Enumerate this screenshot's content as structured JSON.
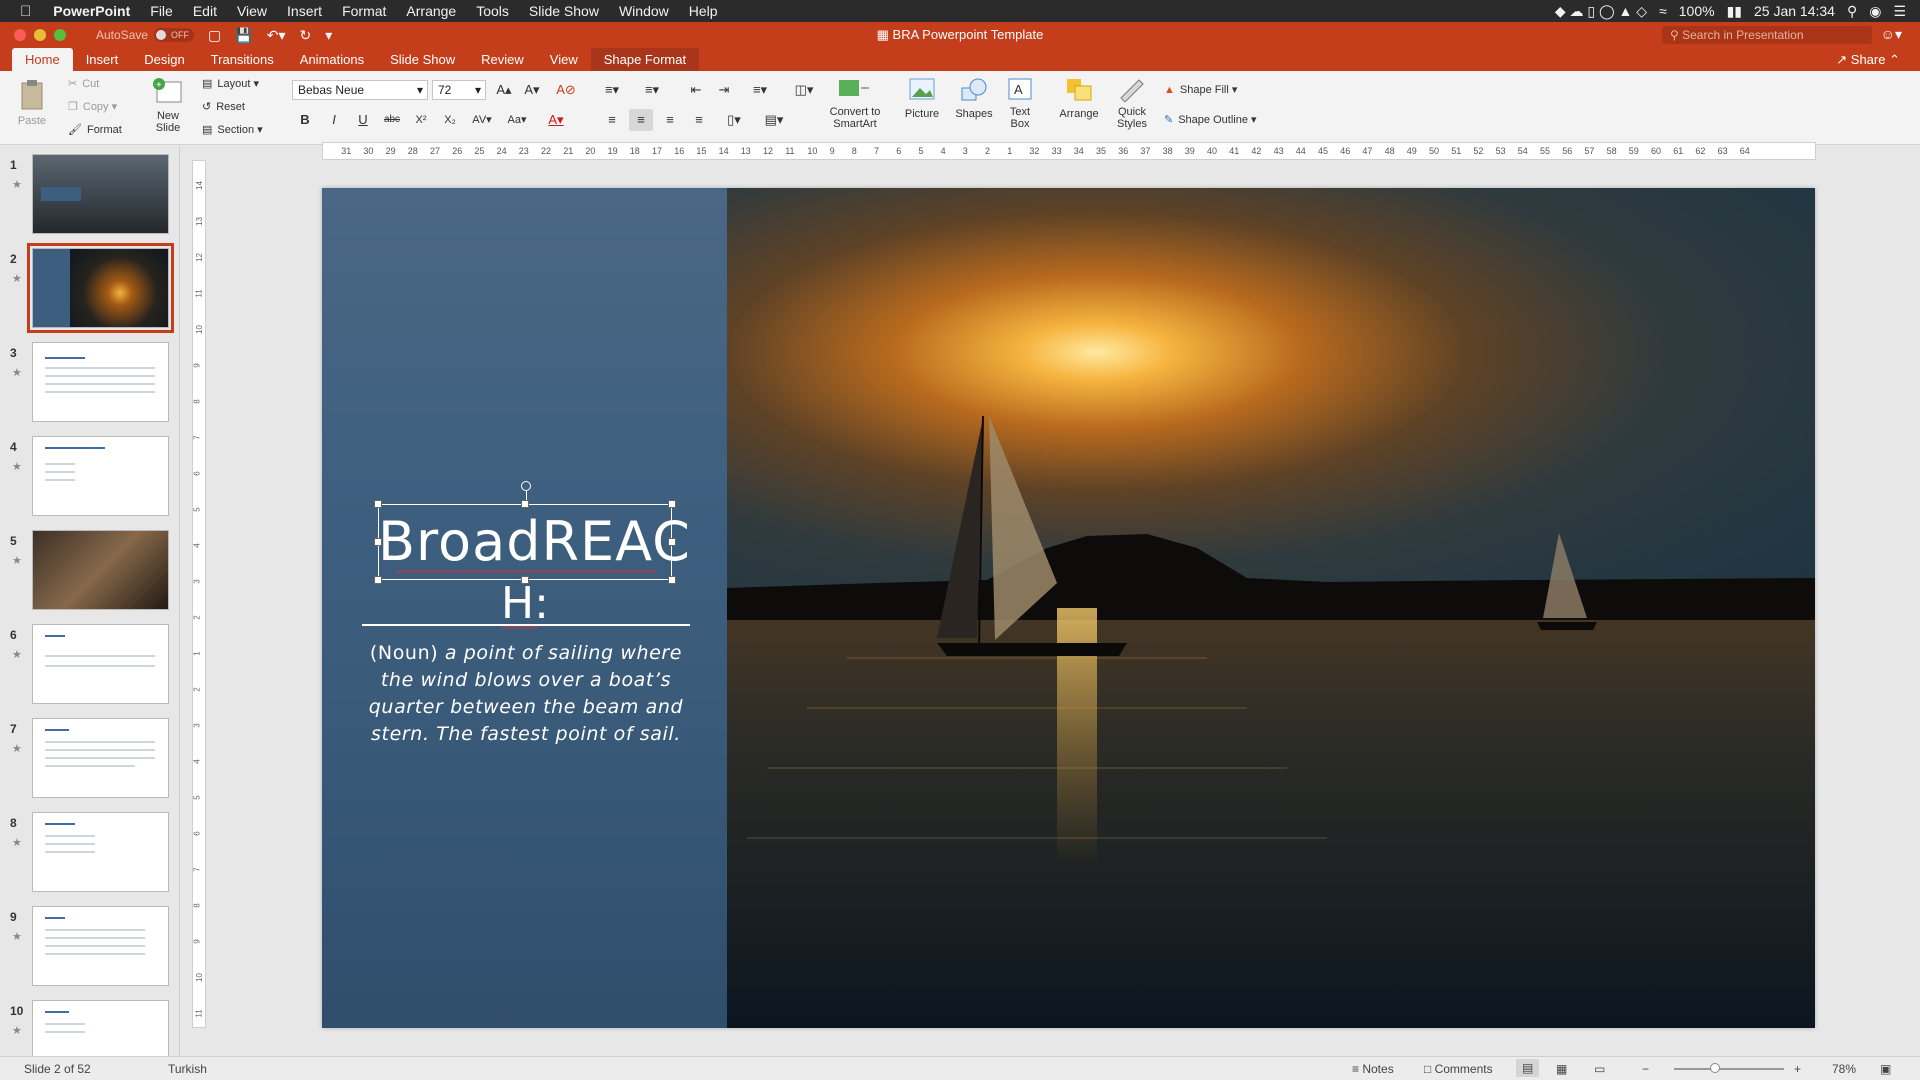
{
  "menubar": {
    "app": "PowerPoint",
    "items": [
      "File",
      "Edit",
      "View",
      "Insert",
      "Format",
      "Arrange",
      "Tools",
      "Slide Show",
      "Window",
      "Help"
    ],
    "battery": "100%",
    "datetime": "25 Jan  14:34"
  },
  "titlebar": {
    "autosave": "AutoSave",
    "autosave_state": "OFF",
    "doc_title": "BRA Powerpoint Template",
    "search_placeholder": "Search in Presentation"
  },
  "tabs": [
    "Home",
    "Insert",
    "Design",
    "Transitions",
    "Animations",
    "Slide Show",
    "Review",
    "View",
    "Shape Format"
  ],
  "active_tab": "Home",
  "share": "Share",
  "ribbon": {
    "paste": "Paste",
    "cut": "Cut",
    "copy": "Copy",
    "format": "Format",
    "new_slide": [
      "New",
      "Slide"
    ],
    "layout": "Layout",
    "reset": "Reset",
    "section": "Section",
    "font_name": "Bebas Neue",
    "font_size": "72",
    "convert": [
      "Convert to",
      "SmartArt"
    ],
    "picture": "Picture",
    "shapes": "Shapes",
    "text_box": [
      "Text",
      "Box"
    ],
    "arrange": "Arrange",
    "quick_styles": [
      "Quick",
      "Styles"
    ],
    "shape_fill": "Shape Fill",
    "shape_outline": "Shape Outline"
  },
  "slide": {
    "title_line1": "BroadREAC",
    "title_line2": "H:",
    "subtitle_noun": "(Noun)",
    "subtitle_rest": "a point of sailing where the wind blows over a boat’s quarter between the beam and stern.  The fastest point of sail."
  },
  "thumbnails": [
    "1",
    "2",
    "3",
    "4",
    "5",
    "6",
    "7",
    "8",
    "9",
    "10"
  ],
  "active_thumbnail": "2",
  "status": {
    "slide": "Slide 2 of 52",
    "language": "Turkish",
    "notes": "Notes",
    "comments": "Comments",
    "zoom": "78%"
  },
  "colors": {
    "accent": "#c43e1c",
    "slide_panel": "#3d5e7e"
  }
}
